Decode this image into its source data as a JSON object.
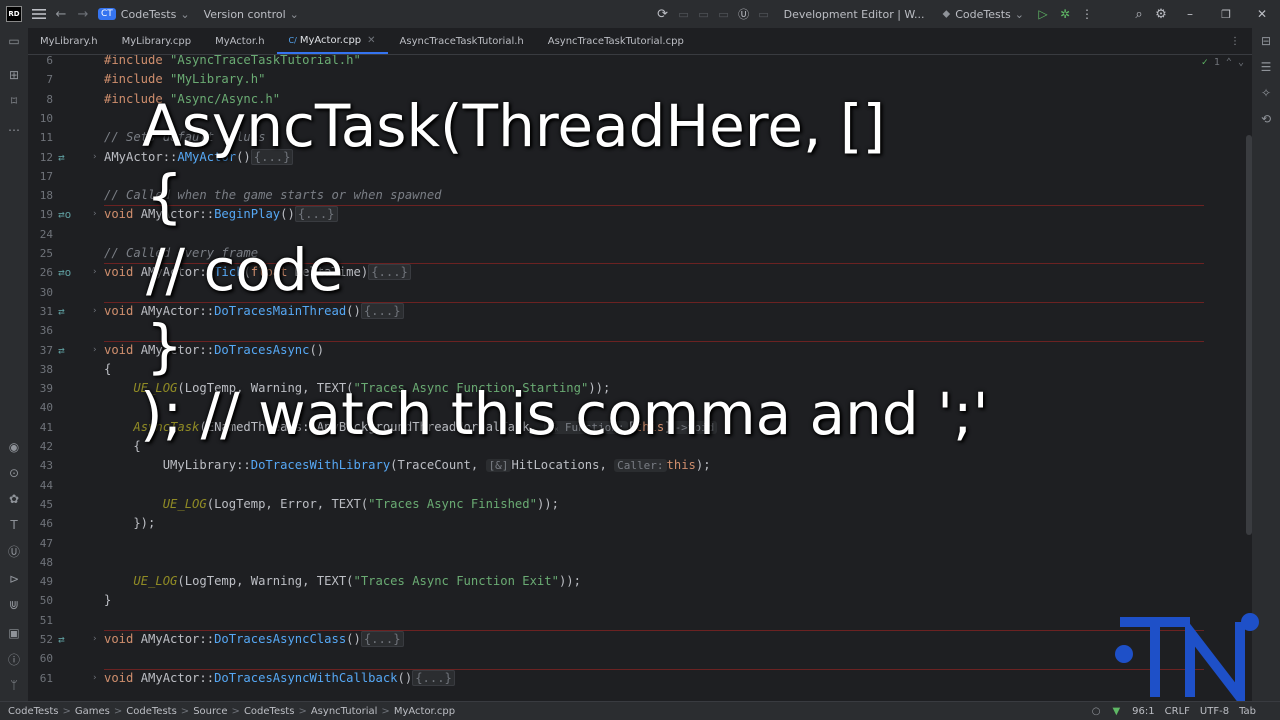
{
  "titlebar": {
    "project_badge": "CT",
    "project_name": "CodeTests",
    "vcs": "Version control",
    "run_config": "Development Editor | W...",
    "target": "CodeTests"
  },
  "tabs": [
    {
      "label": "MyLibrary.h"
    },
    {
      "label": "MyLibrary.cpp"
    },
    {
      "label": "MyActor.h"
    },
    {
      "label": "MyActor.cpp",
      "active": true
    },
    {
      "label": "AsyncTraceTaskTutorial.h"
    },
    {
      "label": "AsyncTraceTaskTutorial.cpp"
    }
  ],
  "inspection_count": "1",
  "lines": [
    {
      "n": "6",
      "html": "<span class='kw'>#include</span> <span class='str'>\"AsyncTraceTaskTutorial.h\"</span>"
    },
    {
      "n": "7",
      "html": "<span class='kw'>#include</span> <span class='str'>\"MyLibrary.h\"</span>"
    },
    {
      "n": "8",
      "html": "<span class='kw'>#include</span> <span class='str'>\"Async/Async.h\"</span>"
    },
    {
      "n": "10",
      "html": ""
    },
    {
      "n": "11",
      "html": "<span class='cm'>// Sets default values</span>"
    },
    {
      "n": "12",
      "html": "AMyActor::<span class='fn'>AMyActor</span>()<span class='fold-box'>{...}</span>",
      "gutter": "⇄"
    },
    {
      "n": "17",
      "html": ""
    },
    {
      "n": "18",
      "html": "<span class='cm'>// Called when the game starts or when spawned</span>"
    },
    {
      "n": "19",
      "html": "<span class='kw'>void</span> AMyActor::<span class='fn'>BeginPlay</span>()<span class='fold-box'>{...}</span>",
      "gutter": "⇄o",
      "sep": true
    },
    {
      "n": "24",
      "html": ""
    },
    {
      "n": "25",
      "html": "<span class='cm'>// Called every frame</span>"
    },
    {
      "n": "26",
      "html": "<span class='kw'>void</span> AMyActor::<span class='fn'>Tick</span>(<span class='kw'>float</span> DeltaTime)<span class='fold-box'>{...}</span>",
      "gutter": "⇄o",
      "sep": true
    },
    {
      "n": "30",
      "html": ""
    },
    {
      "n": "31",
      "html": "<span class='kw'>void</span> AMyActor::<span class='fn'>DoTracesMainThread</span>()<span class='fold-box'>{...}</span>",
      "gutter": "⇄",
      "sep": true
    },
    {
      "n": "36",
      "html": ""
    },
    {
      "n": "37",
      "html": "<span class='kw'>void</span> AMyActor::<span class='fn'>DoTracesAsync</span>()",
      "gutter": "⇄",
      "sep": true
    },
    {
      "n": "38",
      "html": "{"
    },
    {
      "n": "39",
      "html": "    <span class='mac'>UE_LOG</span>(LogTemp, Warning, TEXT(<span class='str'>\"Traces Async Function Starting\"</span>));"
    },
    {
      "n": "40",
      "html": ""
    },
    {
      "n": "41",
      "html": "    <span class='mac'>AsyncTask</span>(ENamedThreads::AnyBackgroundThreadNormalTask, <span class='hint'>⁂ Function:</span>[<span class='kw'>this</span>]<span class='hint'>-&gt;void</span>"
    },
    {
      "n": "42",
      "html": "    {"
    },
    {
      "n": "43",
      "html": "        UMyLibrary::<span class='fn'>DoTracesWithLibrary</span>(TraceCount, <span class='hint'>[&amp;]</span>HitLocations, <span class='hint'>Caller:</span><span class='kw'>this</span>);"
    },
    {
      "n": "44",
      "html": ""
    },
    {
      "n": "45",
      "html": "        <span class='mac'>UE_LOG</span>(LogTemp, Error, TEXT(<span class='str'>\"Traces Async Finished\"</span>));"
    },
    {
      "n": "46",
      "html": "    });"
    },
    {
      "n": "47",
      "html": ""
    },
    {
      "n": "48",
      "html": ""
    },
    {
      "n": "49",
      "html": "    <span class='mac'>UE_LOG</span>(LogTemp, Warning, TEXT(<span class='str'>\"Traces Async Function Exit\"</span>));"
    },
    {
      "n": "50",
      "html": "}"
    },
    {
      "n": "51",
      "html": ""
    },
    {
      "n": "52",
      "html": "<span class='kw'>void</span> AMyActor::<span class='fn'>DoTracesAsyncClass</span>()<span class='fold-box'>{...}</span>",
      "gutter": "⇄",
      "sep": true
    },
    {
      "n": "60",
      "html": ""
    },
    {
      "n": "61",
      "html": "<span class='kw'>void</span> AMyActor::<span class='fn'>DoTracesAsyncWithCallback</span>()<span class='fold-box'>{...}</span>",
      "sep": true
    }
  ],
  "overlay": {
    "line1": "AsyncTask(ThreadHere, []",
    "line2": "{",
    "line3": "// code",
    "line4": "}",
    "line5": "); // watch this comma and ';'"
  },
  "statusbar": {
    "crumbs": [
      "CodeTests",
      "Games",
      "CodeTests",
      "Source",
      "CodeTests",
      "AsyncTutorial",
      "MyActor.cpp"
    ],
    "position": "96:1",
    "line_ending": "CRLF",
    "encoding": "UTF-8",
    "indent": "Tab"
  },
  "colors": {
    "accent": "#3574f0",
    "logo": "#1e50c8",
    "separator": "#6b2222"
  }
}
